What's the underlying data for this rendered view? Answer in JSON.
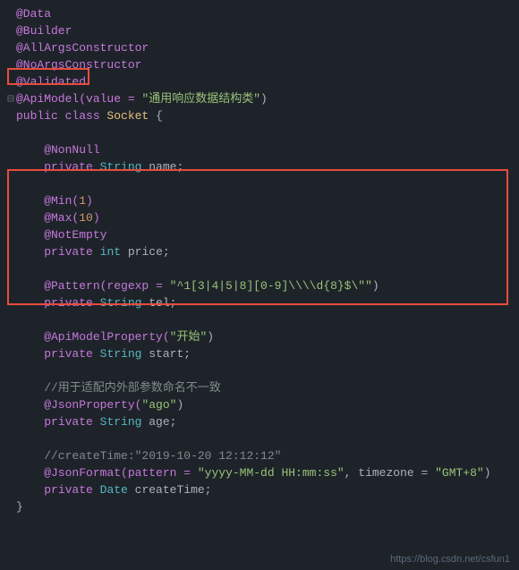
{
  "code": {
    "lines": [
      {
        "num": "",
        "gutter": "",
        "tokens": [
          {
            "text": "@Data",
            "class": "annotation"
          }
        ]
      },
      {
        "num": "",
        "gutter": "",
        "tokens": [
          {
            "text": "@Builder",
            "class": "annotation"
          }
        ]
      },
      {
        "num": "",
        "gutter": "",
        "tokens": [
          {
            "text": "@AllArgsConstructor",
            "class": "annotation"
          }
        ]
      },
      {
        "num": "",
        "gutter": "",
        "tokens": [
          {
            "text": "@NoArgsConstructor",
            "class": "annotation"
          }
        ]
      },
      {
        "num": "",
        "gutter": "",
        "tokens": [
          {
            "text": "@Validated",
            "class": "annotation"
          }
        ]
      },
      {
        "num": "",
        "gutter": "⊟",
        "tokens": [
          {
            "text": "@ApiModel(value = ",
            "class": "annotation"
          },
          {
            "text": "\"通用响应数据结构类\"",
            "class": "string"
          },
          {
            "text": ")",
            "class": "plain"
          }
        ]
      },
      {
        "num": "",
        "gutter": "",
        "tokens": [
          {
            "text": "public ",
            "class": "keyword"
          },
          {
            "text": "class ",
            "class": "keyword"
          },
          {
            "text": "Socket ",
            "class": "class-name"
          },
          {
            "text": "{",
            "class": "plain"
          }
        ]
      },
      {
        "num": "",
        "gutter": "",
        "tokens": []
      },
      {
        "num": "",
        "gutter": "",
        "tokens": [
          {
            "text": "    @NonNull",
            "class": "annotation"
          }
        ]
      },
      {
        "num": "",
        "gutter": "",
        "tokens": [
          {
            "text": "    ",
            "class": "plain"
          },
          {
            "text": "private ",
            "class": "access"
          },
          {
            "text": "String ",
            "class": "type"
          },
          {
            "text": "name;",
            "class": "plain"
          }
        ]
      },
      {
        "num": "",
        "gutter": "",
        "tokens": []
      },
      {
        "num": "",
        "gutter": "",
        "tokens": [
          {
            "text": "    @Min(",
            "class": "annotation"
          },
          {
            "text": "1",
            "class": "number"
          },
          {
            "text": ")",
            "class": "annotation"
          }
        ]
      },
      {
        "num": "",
        "gutter": "",
        "tokens": [
          {
            "text": "    @Max(",
            "class": "annotation"
          },
          {
            "text": "10",
            "class": "number"
          },
          {
            "text": ")",
            "class": "annotation"
          }
        ]
      },
      {
        "num": "",
        "gutter": "",
        "tokens": [
          {
            "text": "    @NotEmpty",
            "class": "annotation"
          }
        ]
      },
      {
        "num": "",
        "gutter": "",
        "tokens": [
          {
            "text": "    ",
            "class": "plain"
          },
          {
            "text": "private ",
            "class": "access"
          },
          {
            "text": "int ",
            "class": "type"
          },
          {
            "text": "price;",
            "class": "plain"
          }
        ]
      },
      {
        "num": "",
        "gutter": "",
        "tokens": []
      },
      {
        "num": "",
        "gutter": "",
        "tokens": [
          {
            "text": "    @Pattern(regexp = ",
            "class": "annotation"
          },
          {
            "text": "\"^1[3|4|5|8][0-9]\\\\\\\\d{8}$\\\"\"",
            "class": "string"
          },
          {
            "text": ")",
            "class": "plain"
          }
        ]
      },
      {
        "num": "",
        "gutter": "",
        "tokens": [
          {
            "text": "    ",
            "class": "plain"
          },
          {
            "text": "private ",
            "class": "access"
          },
          {
            "text": "String ",
            "class": "type"
          },
          {
            "text": "tel;",
            "class": "plain"
          }
        ]
      },
      {
        "num": "",
        "gutter": "",
        "tokens": []
      },
      {
        "num": "",
        "gutter": "",
        "tokens": [
          {
            "text": "    @ApiModelProperty(",
            "class": "annotation"
          },
          {
            "text": "\"开始\"",
            "class": "string"
          },
          {
            "text": ")",
            "class": "plain"
          }
        ]
      },
      {
        "num": "",
        "gutter": "",
        "tokens": [
          {
            "text": "    ",
            "class": "plain"
          },
          {
            "text": "private ",
            "class": "access"
          },
          {
            "text": "String ",
            "class": "type"
          },
          {
            "text": "start;",
            "class": "plain"
          }
        ]
      },
      {
        "num": "",
        "gutter": "",
        "tokens": []
      },
      {
        "num": "",
        "gutter": "",
        "tokens": [
          {
            "text": "    //用于适配内外部参数命名不一致",
            "class": "comment"
          }
        ]
      },
      {
        "num": "",
        "gutter": "",
        "tokens": [
          {
            "text": "    @JsonProperty(",
            "class": "annotation"
          },
          {
            "text": "\"ago\"",
            "class": "string"
          },
          {
            "text": ")",
            "class": "plain"
          }
        ]
      },
      {
        "num": "",
        "gutter": "",
        "tokens": [
          {
            "text": "    ",
            "class": "plain"
          },
          {
            "text": "private ",
            "class": "access"
          },
          {
            "text": "String ",
            "class": "type"
          },
          {
            "text": "age;",
            "class": "plain"
          }
        ]
      },
      {
        "num": "",
        "gutter": "",
        "tokens": []
      },
      {
        "num": "",
        "gutter": "",
        "tokens": [
          {
            "text": "    //createTime:\"2019-10-20 12:12:12\"",
            "class": "comment"
          }
        ]
      },
      {
        "num": "",
        "gutter": "",
        "tokens": [
          {
            "text": "    @JsonFormat(pattern = ",
            "class": "annotation"
          },
          {
            "text": "\"yyyy-MM-dd HH:mm:ss\"",
            "class": "string"
          },
          {
            "text": ", timezone = ",
            "class": "plain"
          },
          {
            "text": "\"GMT+8\"",
            "class": "string"
          },
          {
            "text": ")",
            "class": "plain"
          }
        ]
      },
      {
        "num": "",
        "gutter": "",
        "tokens": [
          {
            "text": "    ",
            "class": "plain"
          },
          {
            "text": "private ",
            "class": "access"
          },
          {
            "text": "Date ",
            "class": "type"
          },
          {
            "text": "createTime;",
            "class": "plain"
          }
        ]
      },
      {
        "num": "",
        "gutter": "",
        "tokens": [
          {
            "text": "}",
            "class": "plain"
          }
        ]
      }
    ],
    "footer_url": "https://blog.csdn.net/csfun1"
  }
}
